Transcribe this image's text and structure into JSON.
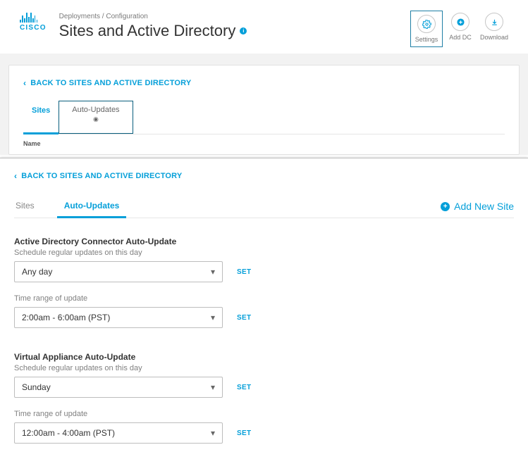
{
  "logo_word": "CISCO",
  "breadcrumb": "Deployments / Configuration",
  "page_title": "Sites and Active Directory",
  "header_actions": {
    "settings": "Settings",
    "add_dc": "Add DC",
    "download": "Download"
  },
  "back_link": "BACK TO SITES AND ACTIVE DIRECTORY",
  "panel1": {
    "tab_sites": "Sites",
    "tab_auto": "Auto-Updates",
    "name_col": "Name"
  },
  "panel2": {
    "tab_sites": "Sites",
    "tab_auto": "Auto-Updates",
    "add_site": "Add New Site"
  },
  "ad_connector": {
    "title": "Active Directory Connector Auto-Update",
    "day_label": "Schedule regular updates on this day",
    "day_value": "Any day",
    "day_set": "SET",
    "time_label": "Time range of update",
    "time_value": "2:00am - 6:00am (PST)",
    "time_set": "SET"
  },
  "va": {
    "title": "Virtual Appliance Auto-Update",
    "day_label": "Schedule regular updates on this day",
    "day_value": "Sunday",
    "day_set": "SET",
    "time_label": "Time range of update",
    "time_value": "12:00am - 4:00am (PST)",
    "time_set": "SET"
  }
}
